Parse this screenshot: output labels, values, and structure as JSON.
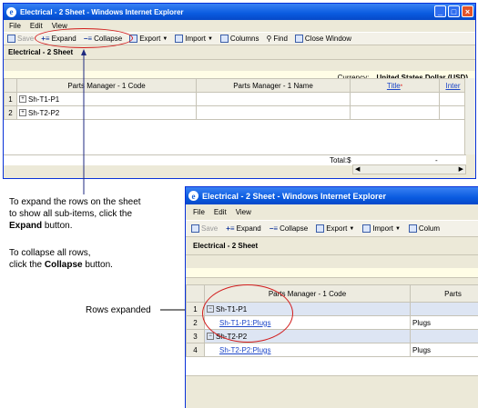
{
  "window1": {
    "title": "Electrical - 2 Sheet - Windows Internet Explorer",
    "menu": [
      "File",
      "Edit",
      "View"
    ],
    "toolbar": {
      "save": "Save",
      "expand": "Expand",
      "collapse": "Collapse",
      "export": "Export",
      "import": "Import",
      "columns": "Columns",
      "find": "Find",
      "close_window": "Close Window"
    },
    "sheet_title": "Electrical - 2 Sheet",
    "currency_label": "Currency:",
    "currency_value": "United States Dollar (USD)",
    "columns": [
      "Parts Manager - 1 Code",
      "Parts Manager - 1 Name",
      "Title",
      "Inter"
    ],
    "rows": [
      {
        "num": "1",
        "code": "Sh-T1-P1"
      },
      {
        "num": "2",
        "code": "Sh-T2-P2"
      }
    ],
    "total_label": "Total:$",
    "total_value": "-"
  },
  "window2": {
    "title": "Electrical - 2 Sheet - Windows Internet Explorer",
    "menu": [
      "File",
      "Edit",
      "View"
    ],
    "toolbar": {
      "save": "Save",
      "expand": "Expand",
      "collapse": "Collapse",
      "export": "Export",
      "import": "Import",
      "columns": "Colum"
    },
    "sheet_title": "Electrical - 2 Sheet",
    "columns": [
      "Parts Manager - 1 Code",
      "Parts"
    ],
    "rows": [
      {
        "num": "1",
        "code": "Sh-T1-P1",
        "parts": "",
        "type": "parent"
      },
      {
        "num": "2",
        "code": "Sh-T1-P1:Plugs",
        "parts": "Plugs",
        "type": "child"
      },
      {
        "num": "3",
        "code": "Sh-T2-P2",
        "parts": "",
        "type": "parent"
      },
      {
        "num": "4",
        "code": "Sh-T2-P2:Plugs",
        "parts": "Plugs",
        "type": "child"
      }
    ]
  },
  "annotations": {
    "expand_line1": "To expand the rows on the sheet",
    "expand_line2": "to show all sub-items, click the",
    "expand_bold": "Expand",
    "expand_tail": " button.",
    "collapse_line1": "To collapse all rows,",
    "collapse_pre": "click the ",
    "collapse_bold": "Collapse",
    "collapse_tail": " button.",
    "rows_expanded": "Rows expanded"
  },
  "colors": {
    "highlight": "#d21d1d",
    "titlebar": "#0a5be0",
    "link": "#1c46c8"
  }
}
